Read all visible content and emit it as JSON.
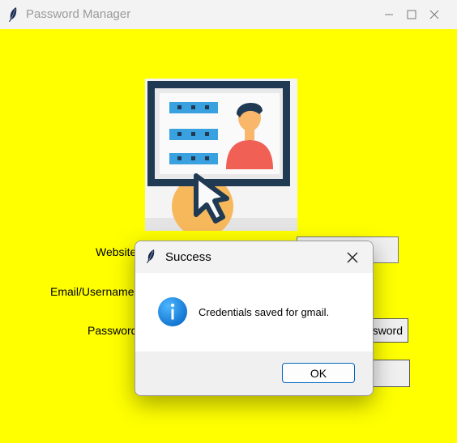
{
  "window": {
    "title": "Password Manager"
  },
  "form": {
    "website_label": "Website:",
    "email_label": "Email/Username:",
    "password_label": "Password:",
    "generate_button_partial": "ssword",
    "colors": {
      "background": "#ffff00"
    }
  },
  "dialog": {
    "title": "Success",
    "message": "Credentials saved for gmail.",
    "ok_label": "OK",
    "icon": "info-icon"
  }
}
